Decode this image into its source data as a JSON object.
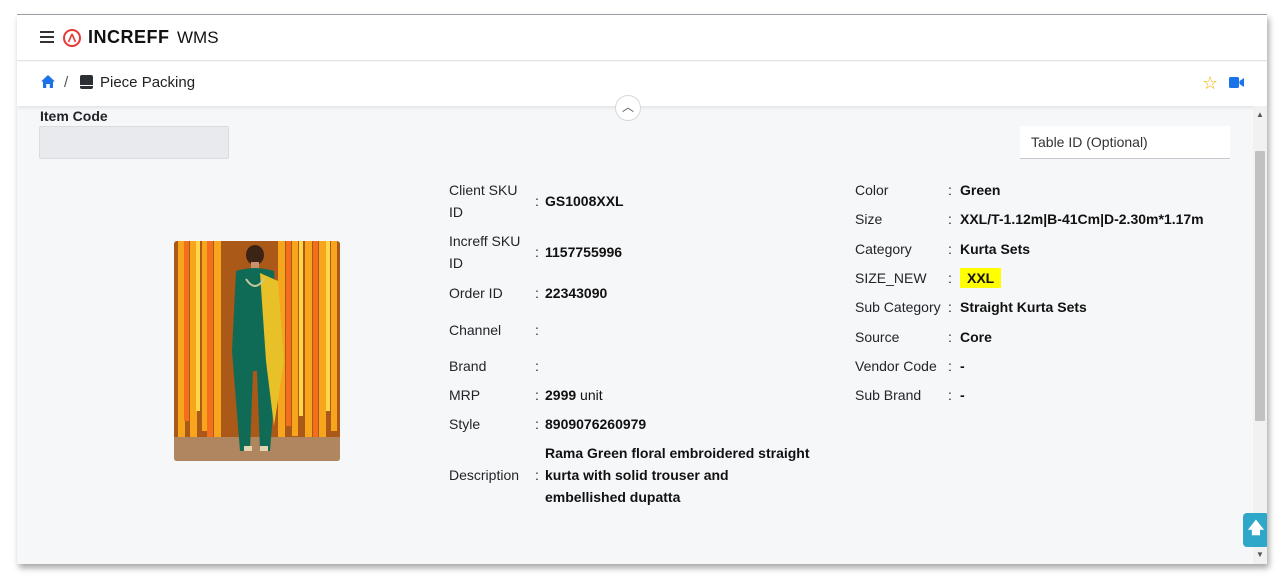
{
  "app": {
    "brand": "INCREFF",
    "brand_sub": "WMS"
  },
  "breadcrumb": {
    "separator": "/",
    "page": "Piece Packing"
  },
  "icons": {
    "menu": "hamburger-icon",
    "home": "home-icon",
    "page": "doc-icon",
    "favorite": "star-icon",
    "video": "video-camera-icon",
    "collapse": "chevron-up-icon",
    "back_to_top": "arrow-up-icon"
  },
  "colors": {
    "accent": "#1a73e8",
    "brand_red": "#e53935",
    "star": "#f4b400",
    "highlight": "#ffff00"
  },
  "form": {
    "item_code_label": "Item Code",
    "item_code_value": "",
    "table_id_placeholder": "Table ID (Optional)"
  },
  "product": {
    "left": [
      {
        "label_1": "Client SKU",
        "label_2": "ID",
        "value": "GS1008XXL"
      },
      {
        "label_1": "Increff SKU",
        "label_2": "ID",
        "value": "1157755996"
      },
      {
        "label": "Order ID",
        "value": "22343090"
      },
      {
        "label": "Channel",
        "value": ""
      },
      {
        "label": "Brand",
        "value": ""
      },
      {
        "label": "MRP",
        "value": "2999",
        "unit": "unit"
      },
      {
        "label": "Style",
        "value": "8909076260979"
      },
      {
        "label": "Description",
        "value_1": "Rama Green floral embroidered straight",
        "value_2": "kurta with solid trouser and",
        "value_3": "embellished dupatta"
      }
    ],
    "right": [
      {
        "label": "Color",
        "value": "Green"
      },
      {
        "label": "Size",
        "value": "XXL/T-1.12m|B-41Cm|D-2.30m*1.17m"
      },
      {
        "label": "Category",
        "value": "Kurta Sets"
      },
      {
        "label": "SIZE_NEW",
        "value": "XXL"
      },
      {
        "label": "Sub Category",
        "value": "Straight Kurta Sets"
      },
      {
        "label": "Source",
        "value": "Core"
      },
      {
        "label": "Vendor Code",
        "value": "-"
      },
      {
        "label": "Sub Brand",
        "value": "-"
      }
    ],
    "colon": ":"
  }
}
